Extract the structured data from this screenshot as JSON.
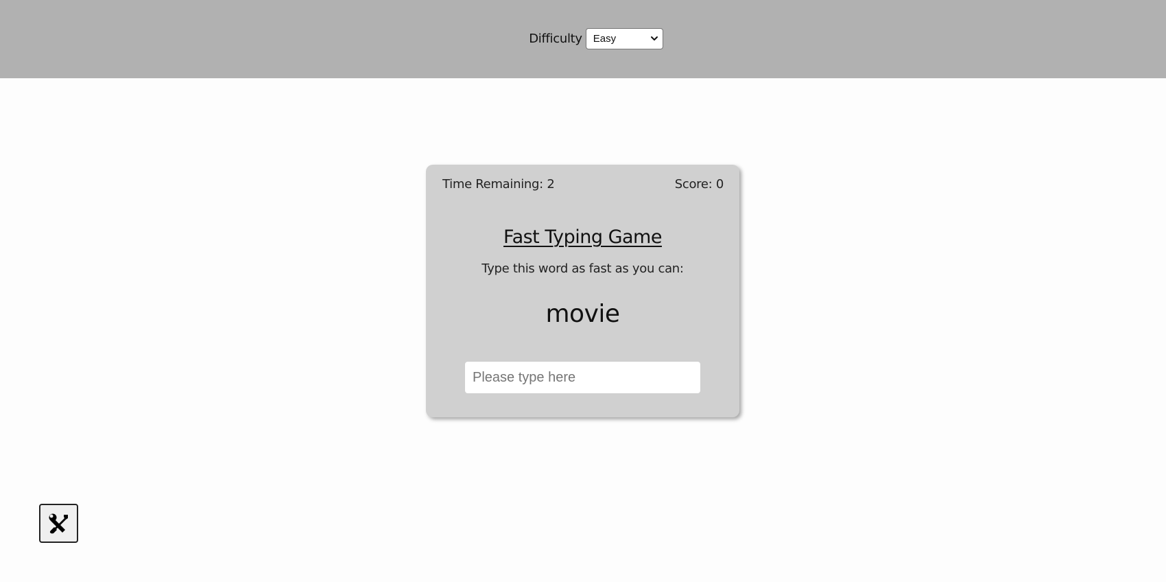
{
  "settings": {
    "difficulty_label": "Difficulty",
    "difficulty_value": "Easy"
  },
  "game": {
    "time_remaining_label": "Time Remaining: 2",
    "score_label": "Score: 0",
    "title": "Fast Typing Game",
    "instructions": "Type this word as fast as you can:",
    "word": "movie",
    "input_placeholder": "Please type here",
    "input_value": ""
  },
  "icons": {
    "settings_button": "tools-icon",
    "select_caret": "chevron-down-icon"
  },
  "colors": {
    "settings_bar": "#b1b1b1",
    "card": "#d0d0d0",
    "page_background": "#fdfdfd"
  }
}
